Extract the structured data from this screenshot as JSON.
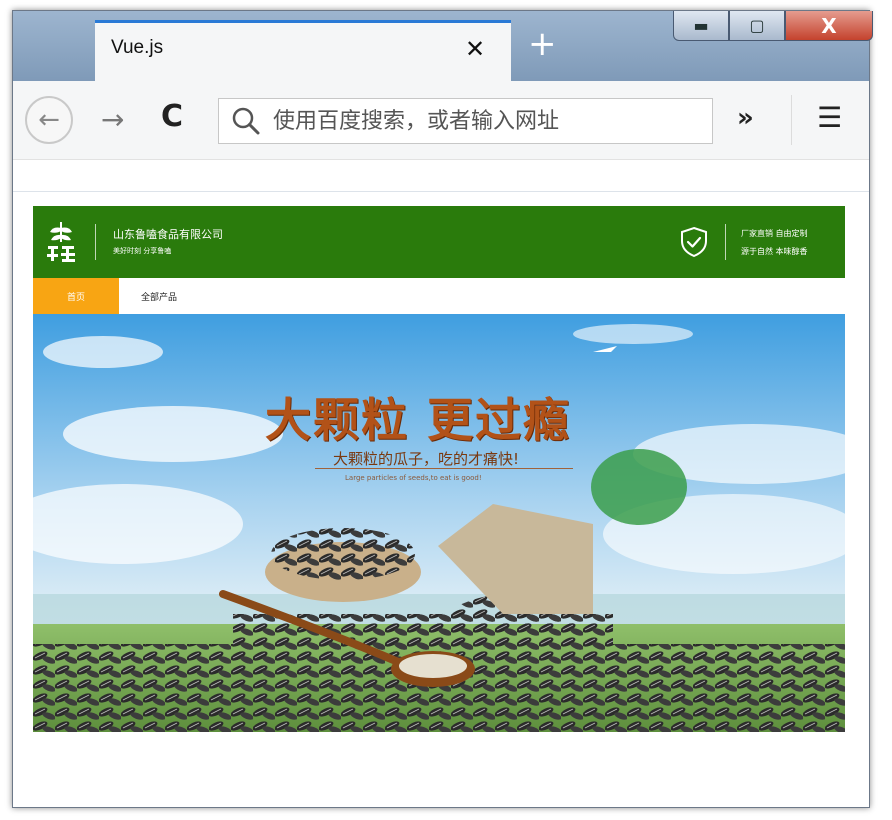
{
  "browser": {
    "tab_title": "Vue.js",
    "tab_close": "✕",
    "new_tab": "+",
    "window_buttons": {
      "minimize": "▬",
      "maximize": "▢",
      "close": "X"
    },
    "nav": {
      "back": "←",
      "forward": "→",
      "reload": "C",
      "overflow": "»",
      "menu": "☰"
    },
    "urlbar": {
      "placeholder": "使用百度搜索，或者输入网址",
      "value": ""
    }
  },
  "site": {
    "header": {
      "company_name": "山东鲁嗑食品有限公司",
      "slogan": "美好时刻 分享鲁嗑",
      "right_line1": "厂家直销 自由定制",
      "right_line2": "源于自然 本味醇香",
      "bg_color": "#2a7b0c"
    },
    "nav": {
      "items": [
        {
          "label": "首页",
          "active": true
        },
        {
          "label": "全部产品",
          "active": false
        }
      ],
      "active_color": "#f8a513"
    },
    "banner": {
      "headline": "大颗粒 更过瘾",
      "subline": "大颗粒的瓜子，吃的才痛快!",
      "english": "Large particles of seeds,to eat is good!"
    }
  },
  "icons": [
    "search-icon",
    "shield-icon",
    "logo-icon",
    "back-arrow-icon",
    "forward-arrow-icon",
    "reload-icon",
    "menu-icon"
  ]
}
